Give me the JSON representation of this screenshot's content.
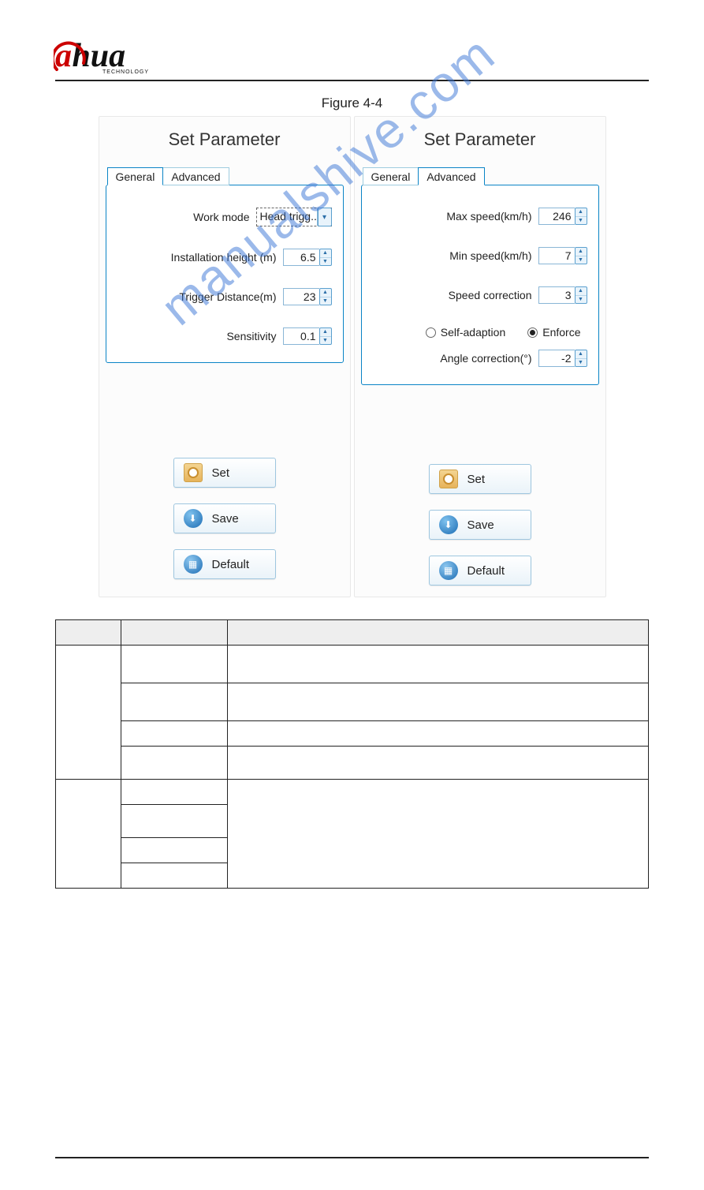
{
  "logo": {
    "brand_a": "a",
    "brand_hua": "hua",
    "tagline": "TECHNOLOGY"
  },
  "figure_caption": "Figure 4-4",
  "watermark": "manualshive.com",
  "panel_left": {
    "title": "Set Parameter",
    "tabs": {
      "general": "General",
      "advanced": "Advanced",
      "active": "general"
    },
    "fields": {
      "work_mode": {
        "label": "Work mode",
        "value": "Head trigg..."
      },
      "install_height": {
        "label": "Installation height (m)",
        "value": "6.5"
      },
      "trigger_distance": {
        "label": "Trigger Distance(m)",
        "value": "23"
      },
      "sensitivity": {
        "label": "Sensitivity",
        "value": "0.1"
      }
    },
    "buttons": {
      "set": "Set",
      "save": "Save",
      "default": "Default"
    }
  },
  "panel_right": {
    "title": "Set Parameter",
    "tabs": {
      "general": "General",
      "advanced": "Advanced",
      "active": "advanced"
    },
    "fields": {
      "max_speed": {
        "label": "Max speed(km/h)",
        "value": "246"
      },
      "min_speed": {
        "label": "Min speed(km/h)",
        "value": "7"
      },
      "speed_corr": {
        "label": "Speed correction",
        "value": "3"
      },
      "angle_corr": {
        "label": "Angle correction(°)",
        "value": "-2"
      },
      "radio": {
        "self_adaption": "Self-adaption",
        "enforce": "Enforce",
        "selected": "enforce"
      }
    },
    "buttons": {
      "set": "Set",
      "save": "Save",
      "default": "Default"
    }
  },
  "table": {
    "header": {
      "tab": "",
      "parameter": "",
      "note": ""
    },
    "rows": [
      {
        "tab": "",
        "param": "",
        "note": "",
        "tab_rowspan": 4,
        "first": true
      },
      {
        "param": "",
        "note": ""
      },
      {
        "param": "",
        "note": ""
      },
      {
        "param": "",
        "note": ""
      },
      {
        "tab": "",
        "param": "",
        "note": "",
        "tab_rowspan": 4,
        "first": true,
        "param_row2": "",
        "big": true
      },
      {
        "param": "",
        "note": ""
      },
      {
        "param": "",
        "note": ""
      }
    ]
  }
}
